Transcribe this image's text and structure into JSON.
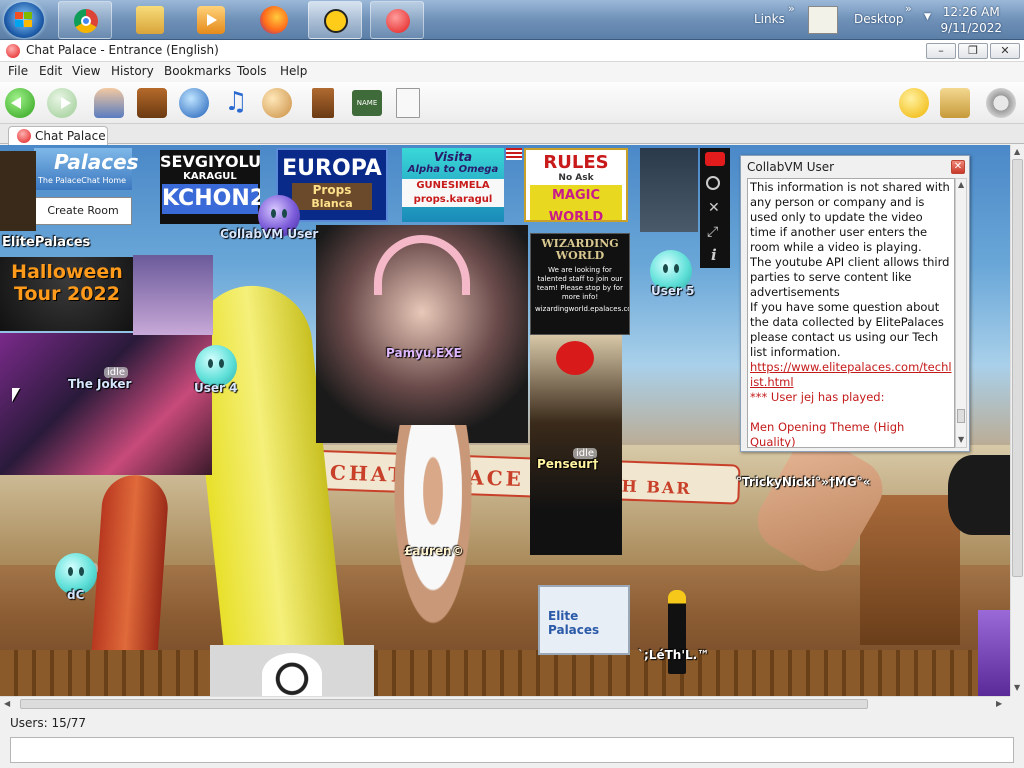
{
  "taskbar": {
    "links_label": "Links",
    "desktop_label": "Desktop",
    "clock_time": "12:26 AM",
    "clock_date": "9/11/2022",
    "chevron": "»"
  },
  "window": {
    "title": "Chat Palace - Entrance (English)",
    "min": "–",
    "max": "❐",
    "close": "✕"
  },
  "menu": {
    "file": "File",
    "edit": "Edit",
    "view": "View",
    "history": "History",
    "bookmarks": "Bookmarks",
    "tools": "Tools",
    "help": "Help"
  },
  "toolbar": {
    "name_badge": "NAME"
  },
  "tab": {
    "label": "Chat Palace"
  },
  "scene": {
    "palaces_logo": "Palaces",
    "palacechat_home": "The PalaceChat Home",
    "create_room": "Create Room",
    "elitepalaces": "ElitePalaces",
    "halloween_line1": "Halloween",
    "halloween_line2": "Tour 2022",
    "sevgiyolu": "SEVGIYOLU",
    "karagul": "KARAGUL",
    "kchon2": "KCHON2",
    "europa": "EUROPA",
    "props": "Props",
    "blanca": "Blanca",
    "visita": "Visita",
    "alpha_omega": "Alpha to Omega",
    "gunesimela": "GUNESIMELA",
    "props_karagul": "props.karagul",
    "rules": "RULES",
    "no_ask": "No  Ask",
    "magic_world": "MAGIC WORLD",
    "wizarding_world": "WIZARDING WORLD",
    "wizarding_text": "We are looking for talented staff to join our team! Please stop by for more info!",
    "wizarding_url": "wizardingworld.epalaces.com:9998",
    "chat_palace_sign": "CHAT PALACE",
    "bar_sign": "H BAR",
    "elite_palaces_sign": "Elite Palaces",
    "idle": "idle"
  },
  "users": {
    "collabvm": "CollabVM User",
    "pamyu": "Pamyu.EXE",
    "user5": "User 5",
    "joker": "The Joker",
    "user4": "User 4",
    "penseur": "Penseur†",
    "tricky": "°TrickyNicki°»†MG°«",
    "lauren": "£auren©",
    "dc": "dC",
    "leth": "`;LéTh'L.™"
  },
  "status": {
    "users_count": "Users: 15/77"
  },
  "dialog": {
    "title": "CollabVM User",
    "close": "✕",
    "p1": "This information is not shared with any person or company and is used only to update the video time if another user enters the room while a video is playing.",
    "p2": "The youtube API client allows third parties to serve content like advertisements",
    "p3": "If you have some question about the data collected by ElitePalaces please contact us using our Tech list information.",
    "link": "https://www.elitepalaces.com/techlist.html",
    "played_heading": "*** User jej has played:",
    "played_item": "Men Opening Theme (High Quality)"
  }
}
